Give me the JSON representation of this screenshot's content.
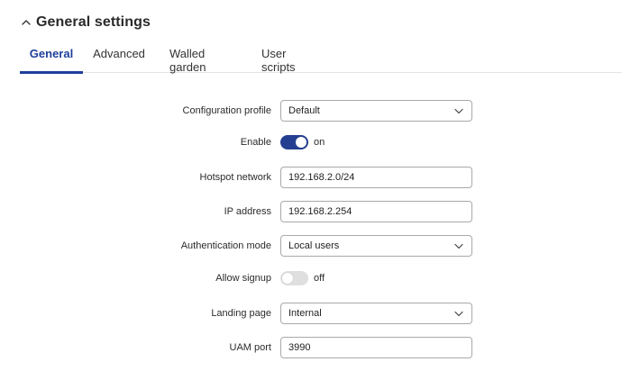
{
  "section": {
    "title": "General settings",
    "collapse_icon": "chevron-up-icon"
  },
  "tabs": [
    {
      "label": "General",
      "active": true
    },
    {
      "label": "Advanced",
      "active": false
    },
    {
      "label": "Walled garden",
      "active": false
    },
    {
      "label": "User scripts",
      "active": false
    }
  ],
  "form": {
    "config_profile": {
      "label": "Configuration profile",
      "value": "Default"
    },
    "enable": {
      "label": "Enable",
      "state": "on"
    },
    "hotspot_network": {
      "label": "Hotspot network",
      "value": "192.168.2.0/24"
    },
    "ip_address": {
      "label": "IP address",
      "value": "192.168.2.254"
    },
    "auth_mode": {
      "label": "Authentication mode",
      "value": "Local users"
    },
    "allow_signup": {
      "label": "Allow signup",
      "state": "off"
    },
    "landing_page": {
      "label": "Landing page",
      "value": "Internal"
    },
    "uam_port": {
      "label": "UAM port",
      "value": "3990"
    }
  },
  "colors": {
    "accent": "#1f3f9b",
    "toggle_on": "#243f8f",
    "toggle_off": "#dfdfdf",
    "border": "#a9a9a9"
  }
}
